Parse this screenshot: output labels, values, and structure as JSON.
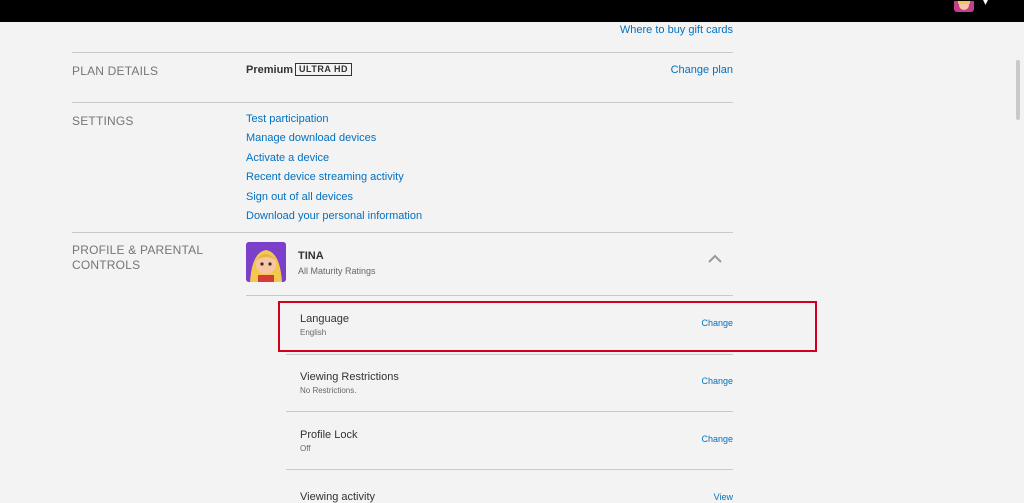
{
  "header": {
    "partial_text": "",
    "caret": "▾"
  },
  "top_link": "Where to buy gift cards",
  "plan": {
    "label": "PLAN DETAILS",
    "name": "Premium",
    "badge": "ULTRA HD",
    "change_label": "Change plan"
  },
  "settings": {
    "label": "SETTINGS",
    "items": [
      "Test participation",
      "Manage download devices",
      "Activate a device",
      "Recent device streaming activity",
      "Sign out of all devices",
      "Download your personal information"
    ]
  },
  "profile": {
    "label_line1": "PROFILE & PARENTAL",
    "label_line2": "CONTROLS",
    "name": "TINA",
    "maturity": "All Maturity Ratings",
    "rows": [
      {
        "title": "Language",
        "value": "English",
        "action": "Change"
      },
      {
        "title": "Viewing Restrictions",
        "value": "No Restrictions.",
        "action": "Change"
      },
      {
        "title": "Profile Lock",
        "value": "Off",
        "action": "Change"
      },
      {
        "title": "Viewing activity",
        "value": "",
        "action": "View"
      }
    ]
  },
  "colors": {
    "link": "#0071c2",
    "highlight": "#d0021b",
    "topbar": "#000000",
    "background": "#f3f3f3"
  }
}
